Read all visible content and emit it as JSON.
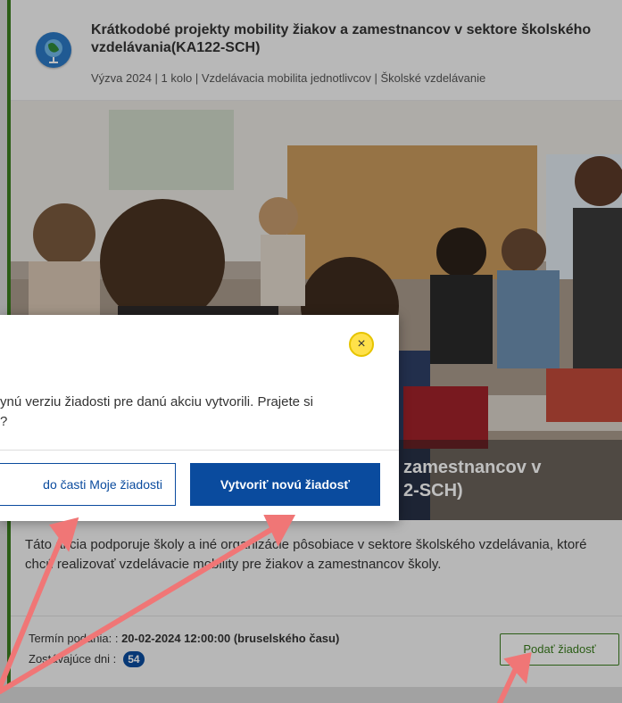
{
  "card": {
    "title": "Krátkodobé projekty mobility žiakov a zamestnancov v sektore školského vzdelávania(KA122-SCH)",
    "subtitle": "Výzva 2024 | 1 kolo | Vzdelávacia mobilita jednotlivcov | Školské vzdelávanie",
    "hero_title": "zamestnancov v\n2-SCH)",
    "description": "Táto akcia podporuje školy a iné organizácie pôsobiace v sektore školského vzdelávania, ktoré chcú realizovať vzdelávacie mobility pre žiakov a zamestnancov školy.",
    "deadline_label": "Termín podania: : ",
    "deadline_value": "20-02-2024 12:00:00 (bruselského času)",
    "remaining_label": "Zostávajúce dni : ",
    "remaining_days": "54",
    "apply_label": "Podať žiadosť",
    "accent_color": "#3a7d1e"
  },
  "modal": {
    "close_icon": "×",
    "message": "ynú verziu žiadosti pre danú akciu vytvorili. Prajete si\n?",
    "secondary_button": "do časti Moje žiadosti",
    "primary_button": "Vytvoriť novú žiadosť",
    "primary_color": "#0a4b9e"
  },
  "annotations": {
    "arrow_color": "#f07676"
  }
}
